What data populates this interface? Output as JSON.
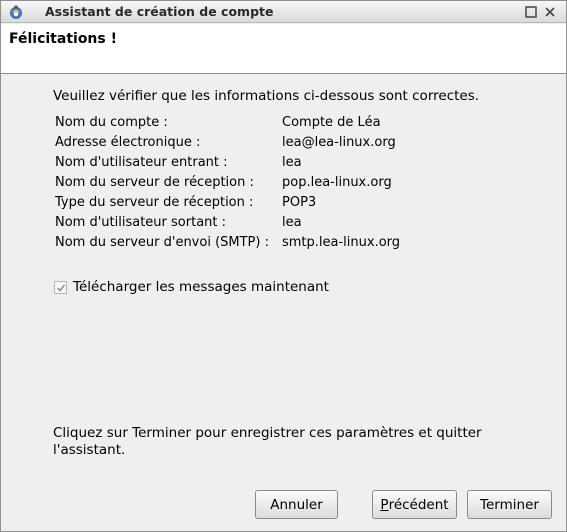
{
  "window": {
    "title": "Assistant de création de compte",
    "icon": "thunderbird-app-icon"
  },
  "header": {
    "title": "Félicitations !"
  },
  "intro": "Veuillez vérifier que les informations ci-dessous sont correctes.",
  "summary": [
    {
      "label": "Nom du compte :",
      "value": "Compte de Léa"
    },
    {
      "label": "Adresse électronique :",
      "value": "lea@lea-linux.org"
    },
    {
      "label": "Nom d'utilisateur entrant :",
      "value": "lea"
    },
    {
      "label": "Nom du serveur de réception :",
      "value": "pop.lea-linux.org"
    },
    {
      "label": "Type du serveur de réception :",
      "value": "POP3"
    },
    {
      "label": "Nom d'utilisateur sortant :",
      "value": "lea"
    },
    {
      "label": "Nom du serveur d'envoi (SMTP) :",
      "value": "smtp.lea-linux.org"
    }
  ],
  "download_now": {
    "label": "Télécharger les messages maintenant",
    "checked": true
  },
  "footer_text": "Cliquez sur Terminer pour enregistrer ces paramètres et quitter l'assistant.",
  "buttons": {
    "cancel": "Annuler",
    "back_mnemonic": "P",
    "back_rest": "récédent",
    "finish": "Terminer"
  }
}
